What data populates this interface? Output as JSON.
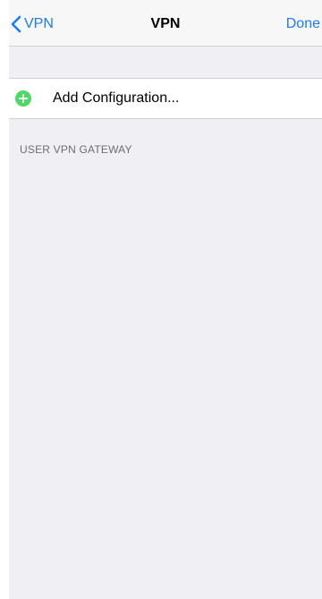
{
  "navbar": {
    "back_label": "VPN",
    "title": "VPN",
    "done_label": "Done"
  },
  "config_group": {
    "add_label": "Add Configuration..."
  },
  "section": {
    "header": "USER VPN GATEWAY"
  },
  "colors": {
    "accent": "#1a7cf5",
    "add_icon": "#4cd964",
    "grouped_background": "#efeff4",
    "cell_background": "#ffffff",
    "section_header_text": "#6d6d72"
  },
  "icons": {
    "back": "chevron-left-icon",
    "add": "plus-circle-icon"
  }
}
